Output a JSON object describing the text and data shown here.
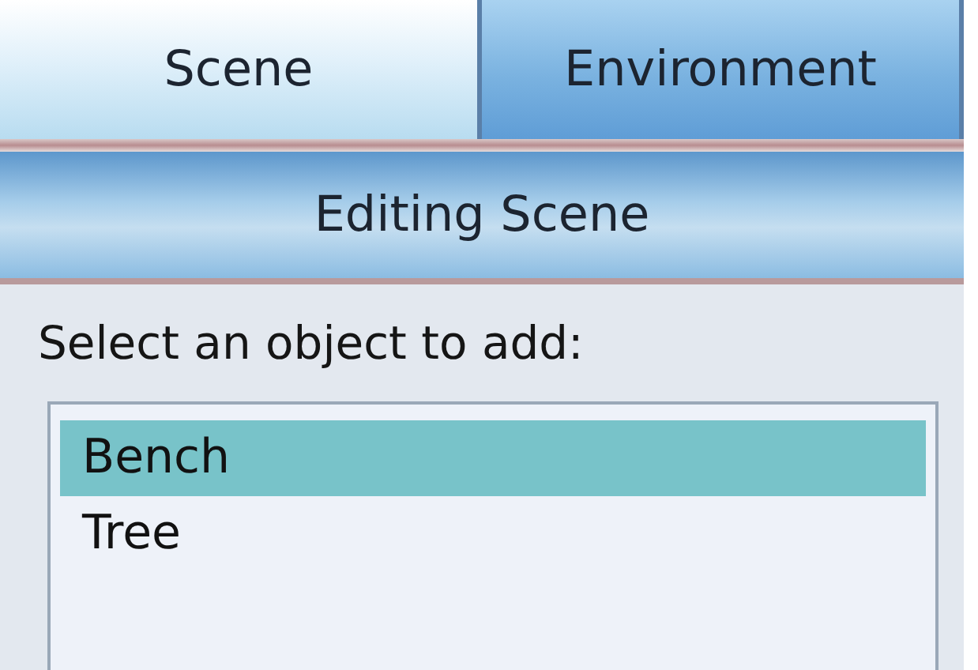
{
  "tabs": [
    {
      "label": "Scene",
      "selected": true
    },
    {
      "label": "Environment",
      "selected": false
    }
  ],
  "header": {
    "title": "Editing Scene"
  },
  "prompt": "Select an object to add:",
  "objects": [
    {
      "label": "Bench",
      "selected": true
    },
    {
      "label": "Tree",
      "selected": false
    }
  ]
}
